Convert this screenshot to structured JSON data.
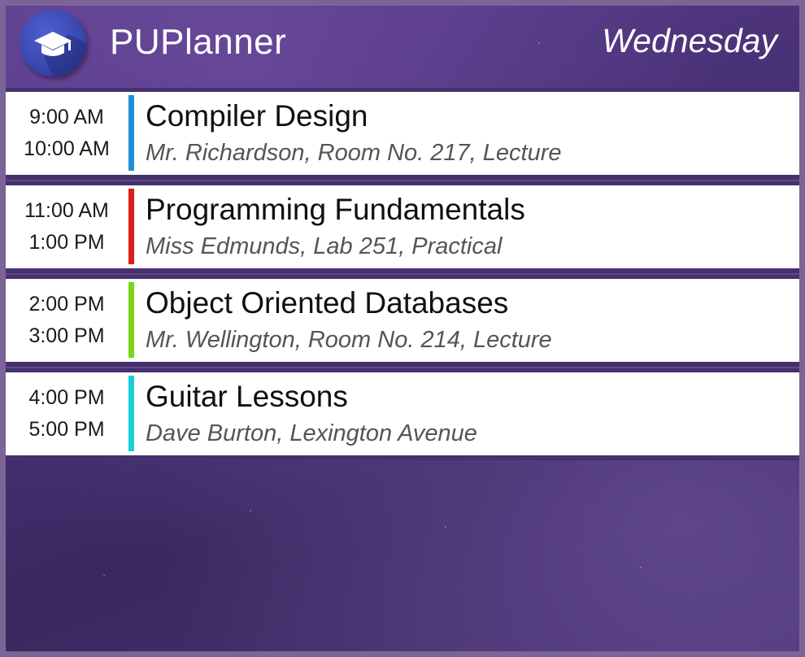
{
  "header": {
    "app_name": "PUPlanner",
    "day": "Wednesday",
    "logo_icon": "graduation-cap-icon"
  },
  "events": [
    {
      "start": "9:00 AM",
      "end": "10:00 AM",
      "subject": "Compiler Design",
      "detail": "Mr. Richardson, Room No. 217, Lecture",
      "color": "#1e8fd6"
    },
    {
      "start": "11:00 AM",
      "end": "1:00 PM",
      "subject": "Programming Fundamentals",
      "detail": "Miss Edmunds, Lab 251, Practical",
      "color": "#e01b1b"
    },
    {
      "start": "2:00 PM",
      "end": "3:00 PM",
      "subject": "Object Oriented Databases",
      "detail": "Mr. Wellington, Room No. 214, Lecture",
      "color": "#7bd41a"
    },
    {
      "start": "4:00 PM",
      "end": "5:00 PM",
      "subject": "Guitar Lessons",
      "detail": "Dave Burton, Lexington Avenue",
      "color": "#19cfd6"
    }
  ]
}
